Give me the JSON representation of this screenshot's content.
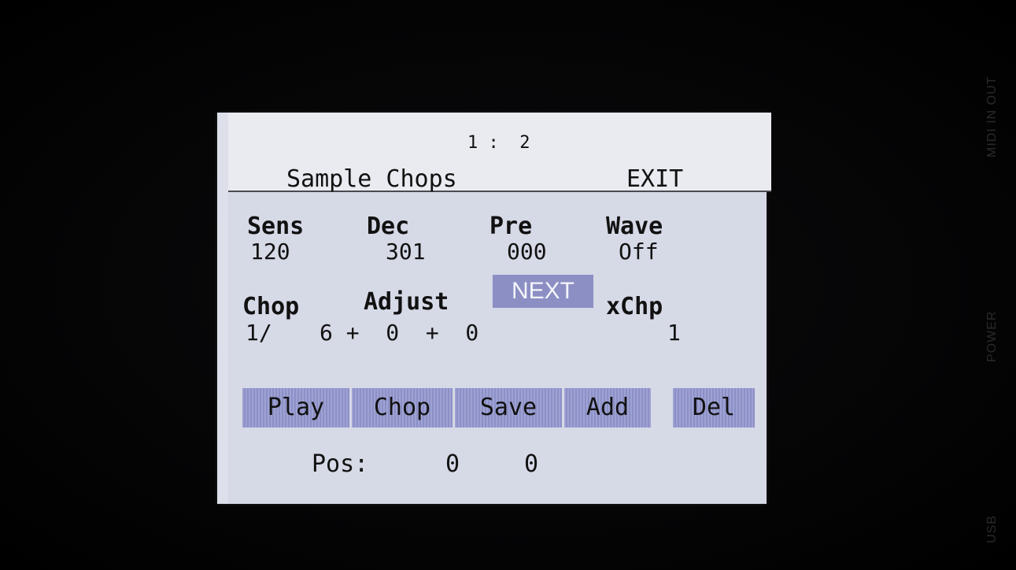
{
  "device": {
    "side_labels": {
      "midi": "MIDI IN OUT",
      "power": "POWER",
      "usb": "USB"
    }
  },
  "header": {
    "page_indicator": "1 :  2",
    "title": "Sample Chops",
    "exit_label": "EXIT"
  },
  "params_row1": [
    {
      "name": "Sens",
      "value": "120"
    },
    {
      "name": "Dec",
      "value": "301"
    },
    {
      "name": "Pre",
      "value": "000"
    },
    {
      "name": "Wave",
      "value": "Off"
    }
  ],
  "params_row2": {
    "chop_label": "Chop",
    "adjust_label": "Adjust",
    "next_label": "NEXT",
    "xchp_label": "xChp",
    "chop_value": "1/",
    "adjust_value": "6 +  0  +  0",
    "xchp_value": "1"
  },
  "buttons": {
    "play": "Play",
    "chop": "Chop",
    "save": "Save",
    "add": "Add",
    "del": "Del"
  },
  "position": {
    "label": "Pos:",
    "value_a": "0",
    "value_b": "0"
  },
  "colors": {
    "screen_bg": "#dde0ea",
    "button_bg": "#9ea2d3",
    "next_bg": "#8b8fc4",
    "text": "#111111"
  }
}
